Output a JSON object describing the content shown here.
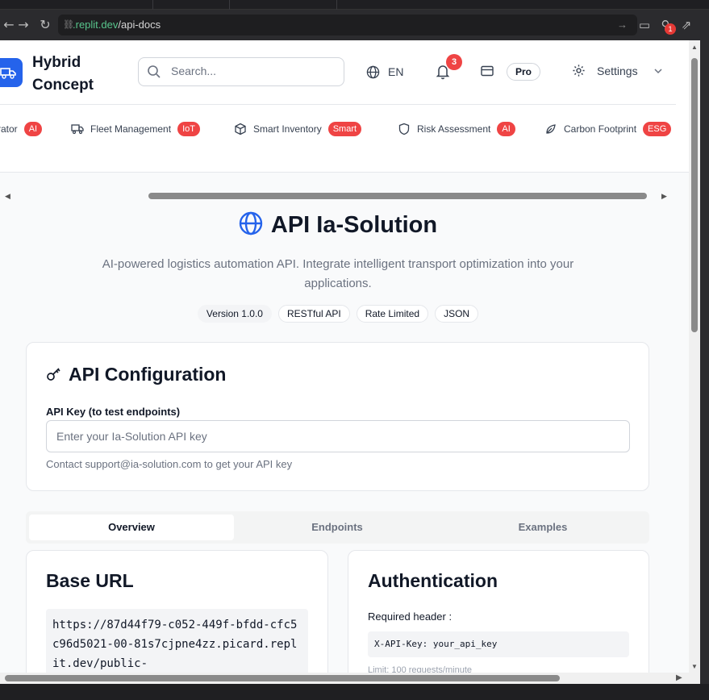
{
  "browser": {
    "url_host": ".replit.dev",
    "url_path": "/api-docs",
    "extension_badge": "1"
  },
  "header": {
    "brand": "Hybrid Concept",
    "search_placeholder": "Search...",
    "language": "EN",
    "notifications_count": "3",
    "plan_badge": "Pro",
    "settings_label": "Settings"
  },
  "modules": [
    {
      "label": "rator",
      "badge": "AI",
      "icon": "generator-icon"
    },
    {
      "label": "Fleet Management",
      "badge": "IoT",
      "icon": "truck-icon"
    },
    {
      "label": "Smart Inventory",
      "badge": "Smart",
      "icon": "package-icon"
    },
    {
      "label": "Risk Assessment",
      "badge": "AI",
      "icon": "shield-icon"
    },
    {
      "label": "Carbon Footprint",
      "badge": "ESG",
      "icon": "leaf-icon"
    }
  ],
  "hero": {
    "title": "API Ia-Solution",
    "subtitle": "AI-powered logistics automation API. Integrate intelligent transport optimization into your applications.",
    "chips": [
      "Version 1.0.0",
      "RESTful API",
      "Rate Limited",
      "JSON"
    ]
  },
  "config": {
    "title": "API Configuration",
    "field_label": "API Key (to test endpoints)",
    "field_placeholder": "Enter your Ia-Solution API key",
    "hint": "Contact support@ia-solution.com to get your API key"
  },
  "tabs": [
    "Overview",
    "Endpoints",
    "Examples"
  ],
  "active_tab": "Overview",
  "base_url": {
    "title": "Base URL",
    "value": "https://87d44f79-c052-449f-bfdd-cfc5c96d5021-00-81s7cjpne4zz.picard.replit.dev/public-"
  },
  "auth": {
    "title": "Authentication",
    "required_label": "Required header :",
    "header_value": "X-API-Key: your_api_key",
    "limit": "Limit: 100 requests/minute"
  },
  "colors": {
    "accent": "#2563eb",
    "badge_red": "#ef4444",
    "url_host_green": "#58c58c"
  }
}
